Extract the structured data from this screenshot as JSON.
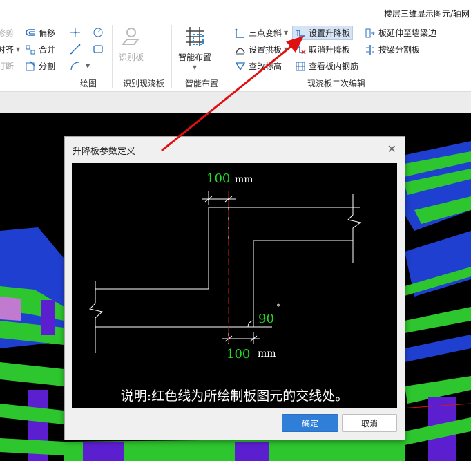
{
  "window": {
    "title": "楼层三维显示图元/轴网"
  },
  "ribbon": {
    "left_tools": [
      {
        "label": "修剪",
        "icon": "trim-icon",
        "disabled": true
      },
      {
        "label": "对齐",
        "icon": "align-icon",
        "disabled": false
      },
      {
        "label": "打断",
        "icon": "break-icon",
        "disabled": true
      }
    ],
    "modify_tools": [
      {
        "label": "偏移",
        "icon": "offset-icon"
      },
      {
        "label": "合并",
        "icon": "merge-icon"
      },
      {
        "label": "分割",
        "icon": "split-icon"
      }
    ],
    "groups": {
      "draw": "绘图",
      "identify": "识别现浇板",
      "smart": "智能布置",
      "secondary_edit": "现浇板二次编辑"
    },
    "identify_board_label": "识别板",
    "smart_layout_label": "智能布置",
    "edit_tools": {
      "three_point_slope": "三点变斜",
      "set_arch_board": "设置拱板",
      "view_elevation": "查改标高",
      "set_drop_board": "设置升降板",
      "cancel_drop_board": "取消升降板",
      "view_rebar": "查看板内钢筋",
      "extend_to_beam": "板延伸至墙梁边",
      "split_by_beam": "按梁分割板"
    }
  },
  "dialog": {
    "title": "升降板参数定义",
    "offset_value_top": "100",
    "offset_value_bottom": "100",
    "unit_top": "mm",
    "unit_bottom": "mm",
    "angle_value": "90",
    "angle_unit": "°",
    "note": "说明:红色线为所绘制板图元的交线处。",
    "ok_label": "确定",
    "cancel_label": "取消"
  },
  "colors": {
    "accent": "#2f7fd9",
    "dim_text": "#22dd22",
    "dim_line": "#ffffff",
    "intersection_line": "#cc2222",
    "annotation_arrow": "#e01010"
  }
}
